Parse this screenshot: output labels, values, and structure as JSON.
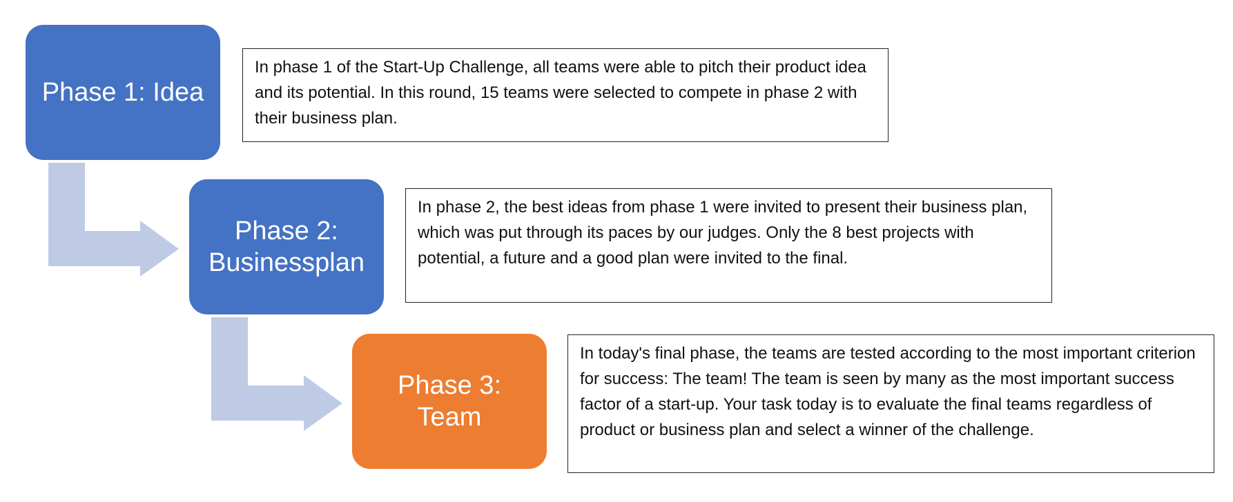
{
  "phases": [
    {
      "title_lines": [
        "Phase 1: Idea"
      ],
      "color": "#4472c4",
      "description": "In phase 1 of the Start-Up Challenge, all teams were able to pitch their product idea and its potential. In this round, 15 teams were selected to compete in phase 2 with their business plan."
    },
    {
      "title_lines": [
        "Phase 2:",
        "Businessplan"
      ],
      "color": "#4472c4",
      "description": "In phase 2, the best ideas from phase 1 were invited to present their business plan, which was put through its paces by our judges. Only the 8 best projects with potential, a future and a good plan were invited to the final."
    },
    {
      "title_lines": [
        "Phase 3:",
        "Team"
      ],
      "color": "#ed7d31",
      "description": "In today's final phase, the teams are tested according to the most important criterion for success: The team! The team is seen by many as the most important success factor of a start-up. Your task today is to evaluate the final teams regardless of product or business plan and select a winner of the challenge."
    }
  ],
  "connector_color": "#bfcbe5"
}
